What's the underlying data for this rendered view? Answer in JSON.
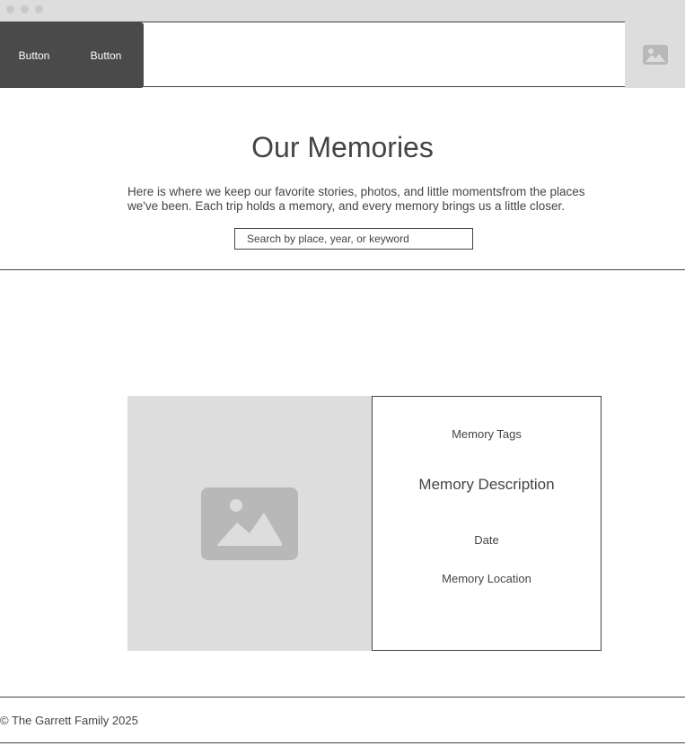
{
  "nav": {
    "buttons": [
      "Button",
      "Button"
    ]
  },
  "header": {
    "image_icon": "image-placeholder-icon"
  },
  "hero": {
    "title": "Our Memories",
    "intro": "Here is where we keep our favorite stories, photos, and little momentsfrom the places we've been. Each trip holds a memory, and every memory brings us a little closer.",
    "search_placeholder": "Search by place, year, or keyword"
  },
  "memory_card": {
    "image_icon": "image-placeholder-icon",
    "tags": "Memory Tags",
    "description": "Memory Description",
    "date": "Date",
    "location": "Memory Location"
  },
  "footer": {
    "text": "© The Garrett Family 2025"
  },
  "colors": {
    "nav_background": "#4a4a4a",
    "placeholder_fill": "#dddddd",
    "placeholder_icon": "#b8b8b8",
    "text": "#444444"
  }
}
